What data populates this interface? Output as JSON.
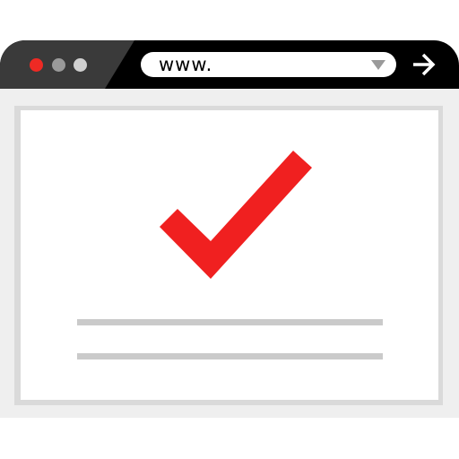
{
  "address_bar": {
    "url": "www."
  },
  "window_controls": {
    "close_color": "#ee2a24",
    "minimize_color": "#9a9a9a",
    "maximize_color": "#d0d0d0"
  },
  "icons": {
    "dropdown": "chevron-down-icon",
    "go": "arrow-right-icon",
    "status": "checkmark-icon"
  },
  "colors": {
    "titlebar": "#000000",
    "accent": "#f02020",
    "page_background": "#efefef"
  }
}
